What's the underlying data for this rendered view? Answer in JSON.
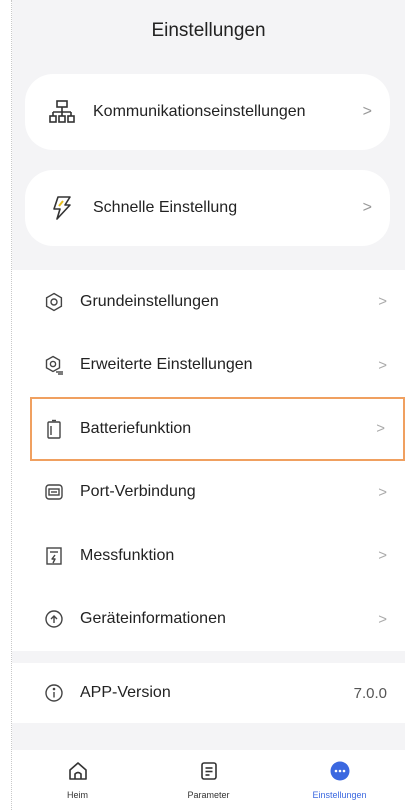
{
  "header": {
    "title": "Einstellungen"
  },
  "cards": [
    {
      "label": "Kommunikationseinstellungen",
      "icon": "network-icon"
    },
    {
      "label": "Schnelle Einstellung",
      "icon": "lightning-icon"
    }
  ],
  "list": [
    {
      "label": "Grundeinstellungen",
      "icon": "gear-icon"
    },
    {
      "label": "Erweiterte Einstellungen",
      "icon": "advanced-gear-icon"
    },
    {
      "label": "Batteriefunktion",
      "icon": "battery-icon"
    },
    {
      "label": "Port-Verbindung",
      "icon": "port-icon"
    },
    {
      "label": "Messfunktion",
      "icon": "meter-icon"
    },
    {
      "label": "Geräteinformationen",
      "icon": "device-info-icon"
    }
  ],
  "version": {
    "label": "APP-Version",
    "value": "7.0.0",
    "icon": "info-icon"
  },
  "chevron": ">",
  "tabbar": {
    "tabs": [
      {
        "label": "Heim",
        "icon": "home-icon"
      },
      {
        "label": "Parameter",
        "icon": "document-icon"
      },
      {
        "label": "Einstellungen",
        "icon": "more-dots-icon",
        "active": true
      }
    ],
    "active_color": "#3b68e0"
  },
  "highlight_color": "#f0a060"
}
